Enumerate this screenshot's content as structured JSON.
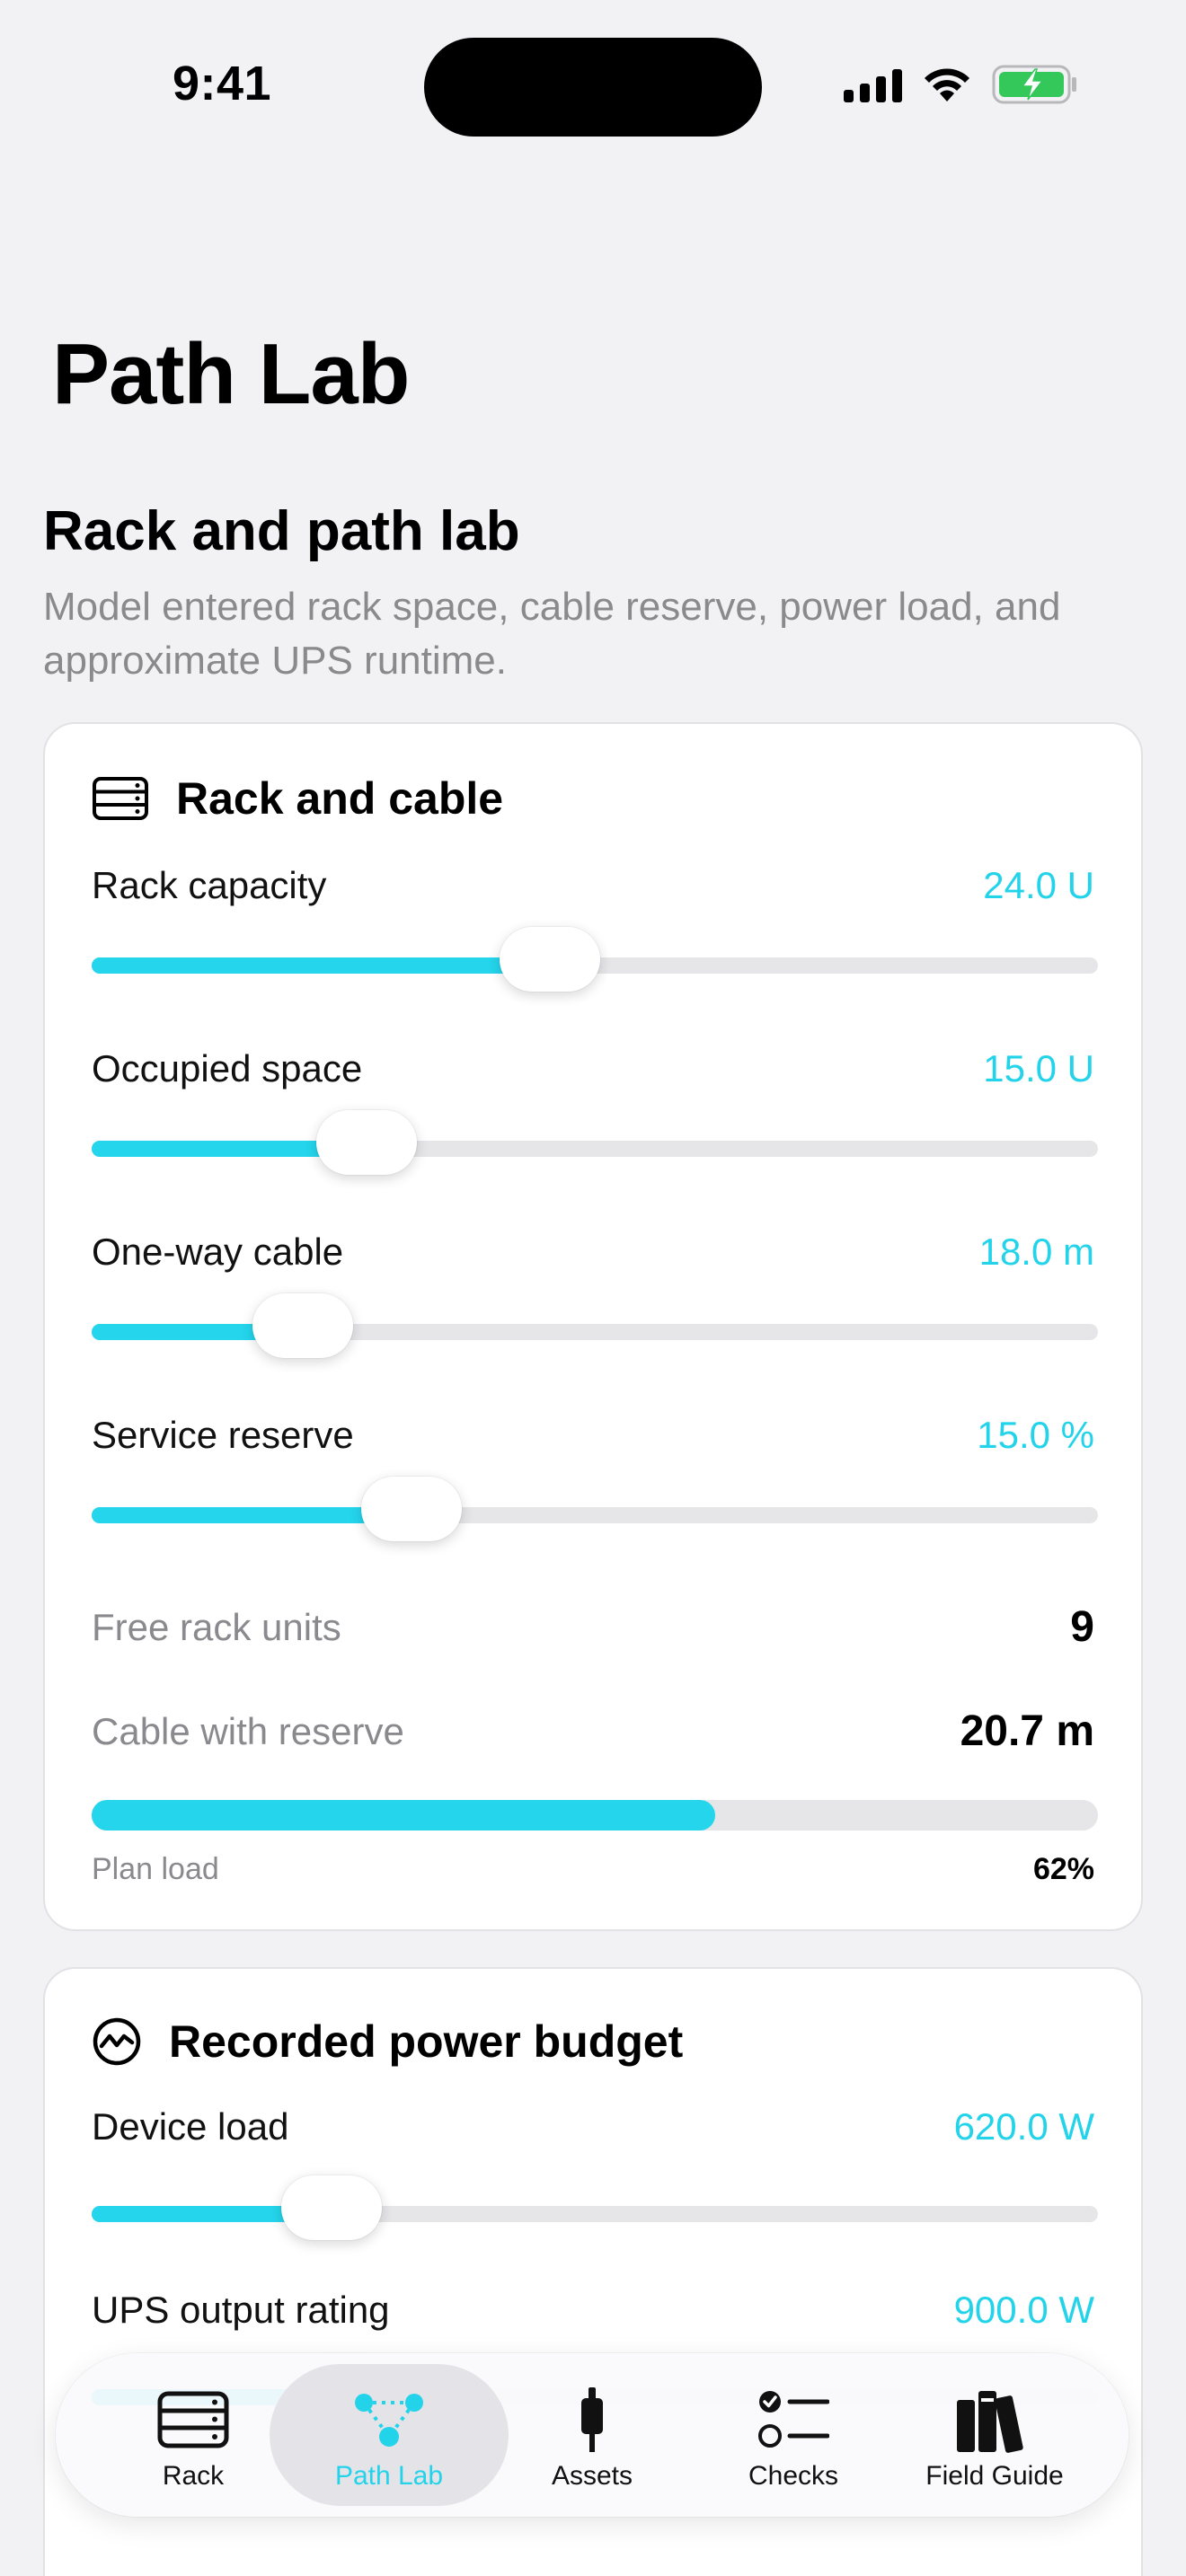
{
  "status_bar": {
    "time": "9:41"
  },
  "nav": {
    "large_title": "Path Lab"
  },
  "section": {
    "title": "Rack and path lab",
    "subtitle": "Model entered rack space, cable reserve, power load, and approximate UPS runtime."
  },
  "rack_card": {
    "title": "Rack and cable",
    "icon": "server-rack-icon",
    "sliders": [
      {
        "label": "Rack capacity",
        "value": "24.0 U",
        "fraction": 0.455
      },
      {
        "label": "Occupied space",
        "value": "15.0 U",
        "fraction": 0.273
      },
      {
        "label": "One-way cable",
        "value": "18.0 m",
        "fraction": 0.21
      },
      {
        "label": "Service reserve",
        "value": "15.0 %",
        "fraction": 0.318
      }
    ],
    "stats": [
      {
        "label": "Free rack units",
        "value": "9"
      },
      {
        "label": "Cable with reserve",
        "value": "20.7 m"
      }
    ],
    "plan_load": {
      "label": "Plan load",
      "value": "62%",
      "fraction": 0.62
    }
  },
  "power_card": {
    "title": "Recorded power budget",
    "icon": "power-meter-icon",
    "sliders": [
      {
        "label": "Device load",
        "value": "620.0 W",
        "fraction": 0.238
      },
      {
        "label": "UPS output rating",
        "value": "900.0 W",
        "fraction": 0.25
      }
    ]
  },
  "tabbar": {
    "tabs": [
      {
        "label": "Rack",
        "icon": "server-rack-icon",
        "active": false
      },
      {
        "label": "Path Lab",
        "icon": "network-path-icon",
        "active": true
      },
      {
        "label": "Assets",
        "icon": "cable-plug-icon",
        "active": false
      },
      {
        "label": "Checks",
        "icon": "checklist-icon",
        "active": false
      },
      {
        "label": "Field Guide",
        "icon": "books-icon",
        "active": false
      }
    ]
  },
  "colors": {
    "accent": "#22d3ea",
    "background": "#f2f2f4",
    "battery": "#34c759"
  }
}
